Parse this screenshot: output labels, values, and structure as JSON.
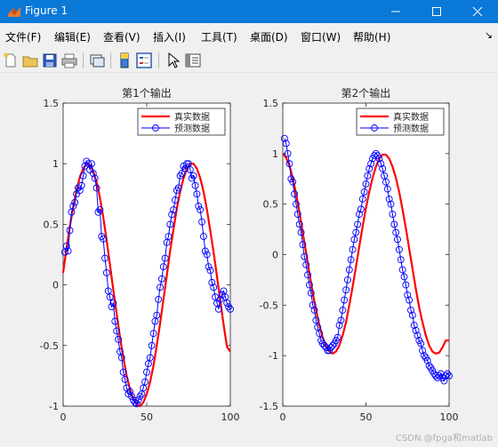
{
  "window": {
    "title": "Figure 1",
    "buttons": [
      "minimize",
      "maximize",
      "close"
    ]
  },
  "menu": {
    "items": [
      {
        "label": "文件(F)"
      },
      {
        "label": "编辑(E)"
      },
      {
        "label": "查看(V)"
      },
      {
        "label": "插入(I)"
      },
      {
        "label": "工具(T)"
      },
      {
        "label": "桌面(D)"
      },
      {
        "label": "窗口(W)"
      },
      {
        "label": "帮助(H)"
      }
    ],
    "overflow_icon": "arrow-icon"
  },
  "toolbar": {
    "tools": [
      "new-figure-icon",
      "open-icon",
      "save-icon",
      "print-icon",
      "link-figure-icon",
      "colorbar-icon",
      "legend-icon",
      "pointer-icon",
      "property-editor-icon"
    ]
  },
  "chart_data": [
    {
      "type": "line",
      "title": "第1个输出",
      "xlim": [
        0,
        100
      ],
      "ylim": [
        -1,
        1.5
      ],
      "xticks": [
        "0",
        "50",
        "100"
      ],
      "yticks": [
        "-1",
        "-0.5",
        "0",
        "0.5",
        "1",
        "1.5"
      ],
      "legend": {
        "position": "top-right",
        "entries": [
          "真实数据",
          "预测数据"
        ]
      },
      "series": [
        {
          "name": "真实数据",
          "color": "#ff0000",
          "style": "line",
          "x": [
            0,
            2,
            4,
            6,
            8,
            10,
            12,
            14,
            16,
            18,
            20,
            22,
            24,
            26,
            28,
            30,
            32,
            34,
            36,
            38,
            40,
            42,
            44,
            46,
            48,
            50,
            52,
            54,
            56,
            58,
            60,
            62,
            64,
            66,
            68,
            70,
            72,
            74,
            76,
            78,
            80,
            82,
            84,
            86,
            88,
            90,
            92,
            94,
            96,
            98,
            100
          ],
          "y": [
            0.1,
            0.3,
            0.48,
            0.64,
            0.78,
            0.89,
            0.96,
            1.0,
            0.99,
            0.94,
            0.85,
            0.72,
            0.56,
            0.37,
            0.17,
            -0.04,
            -0.24,
            -0.43,
            -0.6,
            -0.75,
            -0.86,
            -0.94,
            -0.99,
            -1.0,
            -0.97,
            -0.9,
            -0.8,
            -0.67,
            -0.5,
            -0.32,
            -0.12,
            0.08,
            0.28,
            0.46,
            0.63,
            0.77,
            0.88,
            0.96,
            1.0,
            1.0,
            0.96,
            0.88,
            0.77,
            0.62,
            0.45,
            0.27,
            0.07,
            -0.13,
            -0.33,
            -0.51,
            -0.55
          ]
        },
        {
          "name": "预测数据",
          "color": "#0000ff",
          "style": "line-circle",
          "x": [
            1,
            2,
            3,
            4,
            5,
            6,
            7,
            8,
            9,
            10,
            11,
            12,
            13,
            14,
            15,
            16,
            17,
            18,
            19,
            20,
            21,
            22,
            23,
            24,
            25,
            26,
            27,
            28,
            29,
            30,
            31,
            32,
            33,
            34,
            35,
            36,
            37,
            38,
            39,
            40,
            41,
            42,
            43,
            44,
            45,
            46,
            47,
            48,
            49,
            50,
            51,
            52,
            53,
            54,
            55,
            56,
            57,
            58,
            59,
            60,
            61,
            62,
            63,
            64,
            65,
            66,
            67,
            68,
            69,
            70,
            71,
            72,
            73,
            74,
            75,
            76,
            77,
            78,
            79,
            80,
            81,
            82,
            83,
            84,
            85,
            86,
            87,
            88,
            89,
            90,
            91,
            92,
            93,
            94,
            95,
            96,
            97,
            98,
            99,
            100
          ],
          "y": [
            0.27,
            0.32,
            0.28,
            0.45,
            0.6,
            0.65,
            0.68,
            0.75,
            0.8,
            0.78,
            0.82,
            0.9,
            0.98,
            1.02,
            1.0,
            0.95,
            1.0,
            0.92,
            0.88,
            0.8,
            0.6,
            0.62,
            0.4,
            0.38,
            0.22,
            0.1,
            -0.05,
            -0.1,
            -0.18,
            -0.15,
            -0.3,
            -0.38,
            -0.45,
            -0.55,
            -0.6,
            -0.72,
            -0.78,
            -0.85,
            -0.9,
            -0.88,
            -0.92,
            -0.95,
            -0.97,
            -0.98,
            -0.95,
            -0.92,
            -0.9,
            -0.85,
            -0.8,
            -0.72,
            -0.65,
            -0.6,
            -0.5,
            -0.4,
            -0.3,
            -0.25,
            -0.12,
            -0.02,
            0.05,
            0.15,
            0.22,
            0.35,
            0.4,
            0.5,
            0.58,
            0.62,
            0.7,
            0.78,
            0.8,
            0.9,
            0.92,
            0.98,
            0.96,
            1.0,
            1.0,
            0.95,
            0.88,
            0.9,
            0.82,
            0.75,
            0.65,
            0.62,
            0.52,
            0.4,
            0.28,
            0.25,
            0.15,
            0.12,
            0.02,
            -0.02,
            -0.1,
            -0.15,
            -0.2,
            -0.12,
            -0.08,
            -0.05,
            -0.1,
            -0.15,
            -0.18,
            -0.2
          ]
        }
      ]
    },
    {
      "type": "line",
      "title": "第2个输出",
      "xlim": [
        0,
        100
      ],
      "ylim": [
        -1.5,
        1.5
      ],
      "xticks": [
        "0",
        "50",
        "100"
      ],
      "yticks": [
        "-1.5",
        "-1",
        "-0.5",
        "0",
        "0.5",
        "1",
        "1.5"
      ],
      "legend": {
        "position": "top-right",
        "entries": [
          "真实数据",
          "预测数据"
        ]
      },
      "series": [
        {
          "name": "真实数据",
          "color": "#ff0000",
          "style": "line",
          "x": [
            0,
            2,
            4,
            6,
            8,
            10,
            12,
            14,
            16,
            18,
            20,
            22,
            24,
            26,
            28,
            30,
            32,
            34,
            36,
            38,
            40,
            42,
            44,
            46,
            48,
            50,
            52,
            54,
            56,
            58,
            60,
            62,
            64,
            66,
            68,
            70,
            72,
            74,
            76,
            78,
            80,
            82,
            84,
            86,
            88,
            90,
            92,
            94,
            96,
            98,
            100
          ],
          "y": [
            1.0,
            0.96,
            0.88,
            0.76,
            0.6,
            0.42,
            0.22,
            0.02,
            -0.18,
            -0.38,
            -0.55,
            -0.7,
            -0.82,
            -0.91,
            -0.96,
            -0.98,
            -0.96,
            -0.9,
            -0.8,
            -0.67,
            -0.5,
            -0.32,
            -0.12,
            0.08,
            0.28,
            0.46,
            0.62,
            0.76,
            0.87,
            0.95,
            0.99,
            0.99,
            0.95,
            0.87,
            0.76,
            0.62,
            0.45,
            0.26,
            0.06,
            -0.14,
            -0.34,
            -0.52,
            -0.67,
            -0.8,
            -0.9,
            -0.96,
            -0.98,
            -0.97,
            -0.92,
            -0.85,
            -0.85
          ]
        },
        {
          "name": "预测数据",
          "color": "#0000ff",
          "style": "line-circle",
          "x": [
            1,
            2,
            3,
            4,
            5,
            6,
            7,
            8,
            9,
            10,
            11,
            12,
            13,
            14,
            15,
            16,
            17,
            18,
            19,
            20,
            21,
            22,
            23,
            24,
            25,
            26,
            27,
            28,
            29,
            30,
            31,
            32,
            33,
            34,
            35,
            36,
            37,
            38,
            39,
            40,
            41,
            42,
            43,
            44,
            45,
            46,
            47,
            48,
            49,
            50,
            51,
            52,
            53,
            54,
            55,
            56,
            57,
            58,
            59,
            60,
            61,
            62,
            63,
            64,
            65,
            66,
            67,
            68,
            69,
            70,
            71,
            72,
            73,
            74,
            75,
            76,
            77,
            78,
            79,
            80,
            81,
            82,
            83,
            84,
            85,
            86,
            87,
            88,
            89,
            90,
            91,
            92,
            93,
            94,
            95,
            96,
            97,
            98,
            99,
            100
          ],
          "y": [
            1.15,
            1.1,
            1.0,
            0.9,
            0.75,
            0.72,
            0.6,
            0.5,
            0.4,
            0.3,
            0.22,
            0.1,
            -0.02,
            -0.1,
            -0.2,
            -0.3,
            -0.38,
            -0.5,
            -0.55,
            -0.65,
            -0.72,
            -0.78,
            -0.85,
            -0.88,
            -0.9,
            -0.92,
            -0.95,
            -0.95,
            -0.92,
            -0.9,
            -0.88,
            -0.85,
            -0.82,
            -0.7,
            -0.65,
            -0.55,
            -0.45,
            -0.35,
            -0.25,
            -0.15,
            -0.05,
            0.05,
            0.15,
            0.22,
            0.3,
            0.4,
            0.45,
            0.55,
            0.62,
            0.7,
            0.78,
            0.85,
            0.9,
            0.95,
            0.98,
            1.0,
            0.98,
            0.95,
            0.9,
            0.85,
            0.78,
            0.72,
            0.65,
            0.55,
            0.5,
            0.4,
            0.3,
            0.22,
            0.15,
            0.05,
            -0.05,
            -0.15,
            -0.22,
            -0.3,
            -0.4,
            -0.45,
            -0.55,
            -0.6,
            -0.7,
            -0.75,
            -0.8,
            -0.85,
            -0.88,
            -0.95,
            -1.0,
            -1.02,
            -1.05,
            -1.1,
            -1.12,
            -1.15,
            -1.18,
            -1.2,
            -1.22,
            -1.2,
            -1.18,
            -1.22,
            -1.25,
            -1.2,
            -1.18,
            -1.2
          ]
        }
      ]
    }
  ],
  "watermark": "CSDN @fpga和matlab"
}
